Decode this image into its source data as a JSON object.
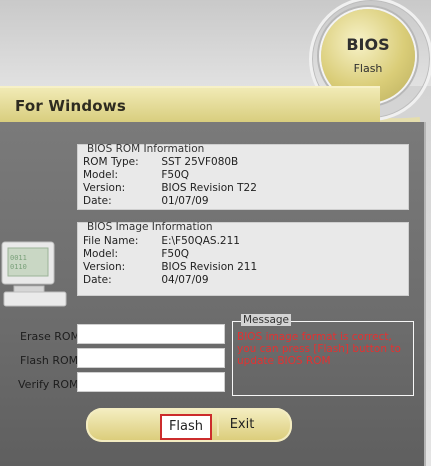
{
  "header": {
    "title": "For Windows",
    "badge_title": "BIOS",
    "badge_sub": "Flash"
  },
  "bios_rom_info": {
    "heading": "BIOS ROM Information",
    "rows": [
      {
        "k": "ROM Type:",
        "v": "SST 25VF080B"
      },
      {
        "k": "Model:",
        "v": "F50Q"
      },
      {
        "k": "Version:",
        "v": "BIOS Revision T22"
      },
      {
        "k": "Date:",
        "v": "01/07/09"
      }
    ]
  },
  "bios_image_info": {
    "heading": "BIOS Image Information",
    "rows": [
      {
        "k": "File Name:",
        "v": "E:\\F50QAS.211"
      },
      {
        "k": "Model:",
        "v": "F50Q"
      },
      {
        "k": "Version:",
        "v": "BIOS Revision 211"
      },
      {
        "k": "Date:",
        "v": "04/07/09"
      }
    ]
  },
  "form": {
    "erase_label": "Erase ROM",
    "flash_label": "Flash ROM",
    "verify_label": "Verify ROM"
  },
  "message": {
    "caption": "Message",
    "text": "BIOS image format is correct, you can press [Flash] button to update BIOS ROM"
  },
  "buttons": {
    "flash_label": "Flash",
    "exit_label": "Exit"
  },
  "icons": {
    "badge": "bios-flash-badge-icon",
    "monitor": "monitor-icon"
  }
}
